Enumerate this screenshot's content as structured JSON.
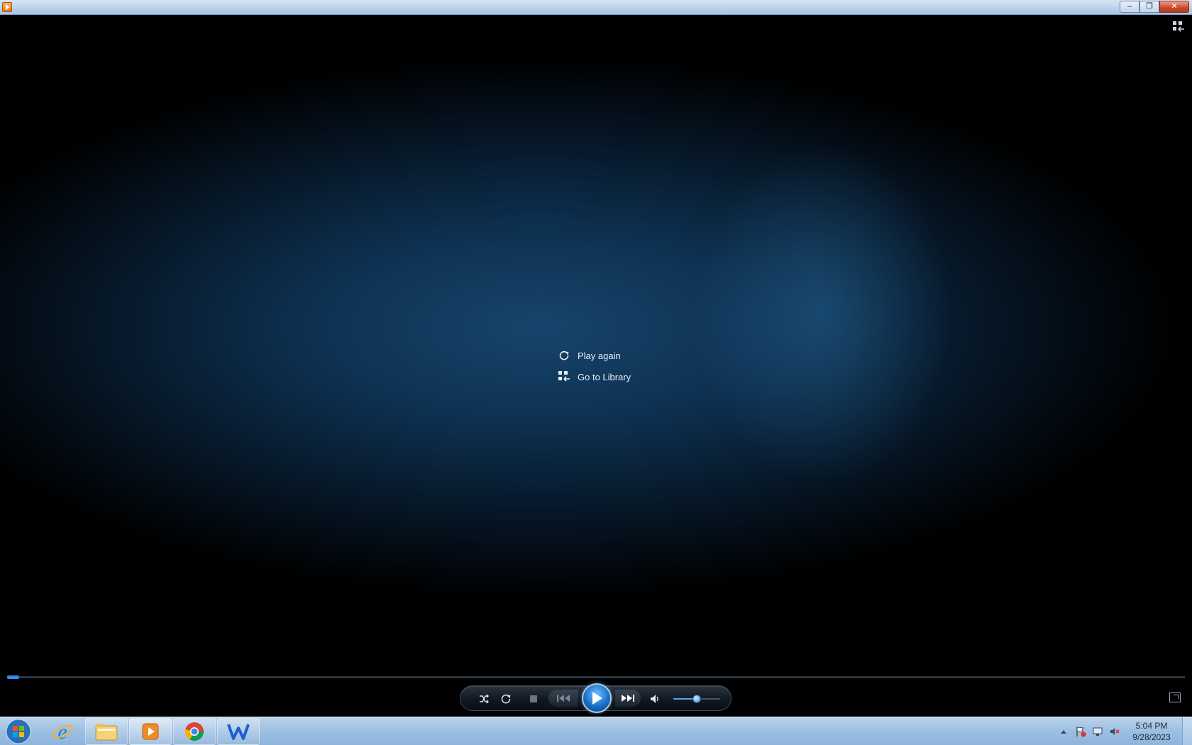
{
  "window": {
    "app_icon": "media-player-icon",
    "controls": {
      "minimize": "–",
      "restore": "❐",
      "close": "✕"
    }
  },
  "end_menu": {
    "items": [
      {
        "label": "Play again",
        "icon": "replay-icon"
      },
      {
        "label": "Go to Library",
        "icon": "library-icon"
      }
    ]
  },
  "playback": {
    "progress_fraction": 0.01,
    "volume_fraction": 0.5
  },
  "transport": {
    "buttons": [
      "shuffle-icon",
      "repeat-icon",
      "stop-icon",
      "previous-icon",
      "play-icon",
      "next-icon",
      "volume-icon"
    ]
  },
  "taskbar": {
    "pinned": [
      "internet-explorer-icon",
      "file-explorer-icon",
      "media-player-icon",
      "chrome-icon",
      "wps-writer-icon"
    ],
    "clock": {
      "time": "5:04 PM",
      "date": "9/28/2023"
    }
  },
  "colors": {
    "accent": "#2f8fe8",
    "background_blue": "#16456b"
  }
}
